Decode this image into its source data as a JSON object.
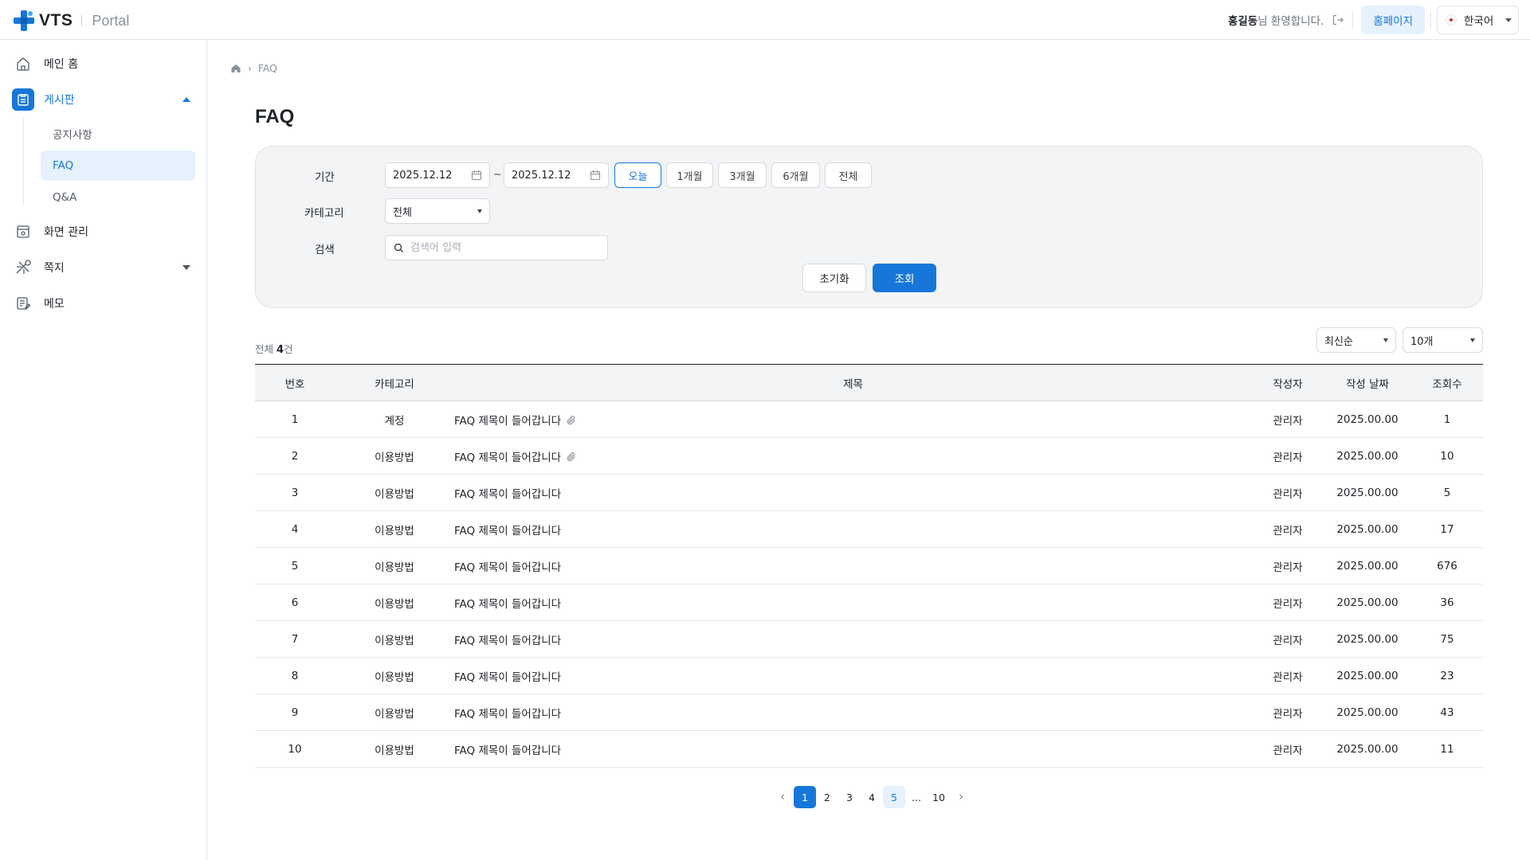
{
  "header": {
    "logo_text": "VTS",
    "logo_sub": "Portal",
    "user_name": "홍길동",
    "welcome_suffix": "님 환영합니다.",
    "home_label": "홈페이지",
    "language": "한국어",
    "accent": "#1677d9"
  },
  "sidebar": {
    "items": [
      {
        "label": "메인 홈",
        "icon": "home-icon"
      },
      {
        "label": "게시판",
        "icon": "board-icon",
        "expanded": true,
        "active": true
      },
      {
        "label": "화면 관리",
        "icon": "screen-manage-icon"
      },
      {
        "label": "쪽지",
        "icon": "message-icon",
        "expanded": false
      },
      {
        "label": "메모",
        "icon": "memo-icon"
      }
    ],
    "sub_items": [
      {
        "label": "공지사항"
      },
      {
        "label": "FAQ",
        "active": true
      },
      {
        "label": "Q&A"
      }
    ]
  },
  "breadcrumb": {
    "current": "FAQ"
  },
  "page": {
    "title": "FAQ"
  },
  "filter": {
    "period_label": "기간",
    "start_date": "2025.12.12",
    "end_date": "2025.12.12",
    "tilde": "~",
    "period_buttons": [
      "오늘",
      "1개월",
      "3개월",
      "6개월",
      "전체"
    ],
    "active_period": "오늘",
    "category_label": "카테고리",
    "category_value": "전체",
    "search_label": "검색",
    "search_placeholder": "검색어 입력",
    "reset_label": "초기화",
    "submit_label": "조회"
  },
  "list": {
    "total_prefix": "전체",
    "total_count": "4",
    "total_suffix": "건",
    "sort_value": "최신순",
    "page_size_value": "10개",
    "columns": [
      "번호",
      "카테고리",
      "제목",
      "작성자",
      "작성 날짜",
      "조회수"
    ],
    "rows": [
      {
        "no": "1",
        "category": "계정",
        "title": "FAQ 제목이 들어갑니다",
        "attachment": true,
        "author": "관리자",
        "date": "2025.00.00",
        "views": "1"
      },
      {
        "no": "2",
        "category": "이용방법",
        "title": "FAQ 제목이 들어갑니다",
        "attachment": true,
        "author": "관리자",
        "date": "2025.00.00",
        "views": "10"
      },
      {
        "no": "3",
        "category": "이용방법",
        "title": "FAQ 제목이 들어갑니다",
        "attachment": false,
        "author": "관리자",
        "date": "2025.00.00",
        "views": "5"
      },
      {
        "no": "4",
        "category": "이용방법",
        "title": "FAQ 제목이 들어갑니다",
        "attachment": false,
        "author": "관리자",
        "date": "2025.00.00",
        "views": "17"
      },
      {
        "no": "5",
        "category": "이용방법",
        "title": "FAQ 제목이 들어갑니다",
        "attachment": false,
        "author": "관리자",
        "date": "2025.00.00",
        "views": "676"
      },
      {
        "no": "6",
        "category": "이용방법",
        "title": "FAQ 제목이 들어갑니다",
        "attachment": false,
        "author": "관리자",
        "date": "2025.00.00",
        "views": "36"
      },
      {
        "no": "7",
        "category": "이용방법",
        "title": "FAQ 제목이 들어갑니다",
        "attachment": false,
        "author": "관리자",
        "date": "2025.00.00",
        "views": "75"
      },
      {
        "no": "8",
        "category": "이용방법",
        "title": "FAQ 제목이 들어갑니다",
        "attachment": false,
        "author": "관리자",
        "date": "2025.00.00",
        "views": "23"
      },
      {
        "no": "9",
        "category": "이용방법",
        "title": "FAQ 제목이 들어갑니다",
        "attachment": false,
        "author": "관리자",
        "date": "2025.00.00",
        "views": "43"
      },
      {
        "no": "10",
        "category": "이용방법",
        "title": "FAQ 제목이 들어갑니다",
        "attachment": false,
        "author": "관리자",
        "date": "2025.00.00",
        "views": "11"
      }
    ]
  },
  "pagination": {
    "prev": "‹",
    "pages": [
      "1",
      "2",
      "3",
      "4",
      "5"
    ],
    "current": "1",
    "hovered": "5",
    "ellipsis": "...",
    "last": "10",
    "next": "›"
  }
}
